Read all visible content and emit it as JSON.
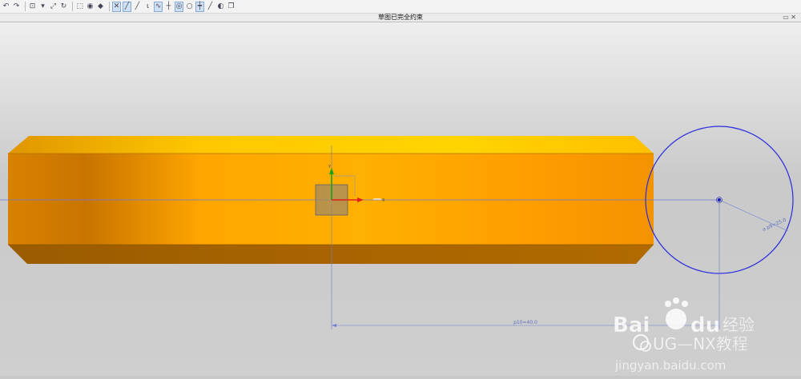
{
  "toolbar": {
    "buttons": [
      {
        "name": "undo-button",
        "glyph": "↶"
      },
      {
        "name": "redo-button",
        "glyph": "↷"
      },
      {
        "name": "select-filter-button",
        "glyph": "⊡"
      },
      {
        "name": "snap-button",
        "glyph": "▾"
      },
      {
        "name": "fit-view-button",
        "glyph": "⤢"
      },
      {
        "name": "refresh-button",
        "glyph": "↻"
      },
      {
        "name": "box-select-button",
        "glyph": "⬚"
      },
      {
        "name": "shaded-view-button",
        "glyph": "◉"
      },
      {
        "name": "cube-view-button",
        "glyph": "◆"
      },
      {
        "name": "profile-tool-button",
        "glyph": "✕",
        "active": true
      },
      {
        "name": "line-tool-button",
        "glyph": "╱",
        "active": true
      },
      {
        "name": "arc-tool-button",
        "glyph": "╱"
      },
      {
        "name": "fillet-tool-button",
        "glyph": "ι"
      },
      {
        "name": "studio-spline-button",
        "glyph": "∿",
        "active": true
      },
      {
        "name": "point-tool-button",
        "glyph": "┼"
      },
      {
        "name": "circle-tool-button",
        "glyph": "◎",
        "active": true
      },
      {
        "name": "polygon-tool-button",
        "glyph": "○"
      },
      {
        "name": "trim-tool-button",
        "glyph": "┿",
        "active": true
      },
      {
        "name": "extend-tool-button",
        "glyph": "╱"
      },
      {
        "name": "mirror-tool-button",
        "glyph": "◐"
      },
      {
        "name": "copy-tool-button",
        "glyph": "❐"
      }
    ]
  },
  "status": {
    "message": "草图已完全约束",
    "right_glyph": "▭ ✕"
  },
  "sketch": {
    "axis_x_label": "X",
    "axis_y_label": "Y",
    "circle_diameter_label": "⌀ p9=25.0",
    "horizontal_dimension_label": "p10=40.0"
  },
  "colors": {
    "body_top": "#ffc400",
    "body_front": "#ff9f00",
    "body_bottom": "#c87800",
    "sketch_blue": "#2a2ae0",
    "dimension_blue": "#6d7fd0"
  },
  "watermark": {
    "brand": "Bai",
    "brand_suffix": "du",
    "brand_cn": "经验",
    "channel": "UG—NX教程",
    "url": "jingyan.baidu.com"
  }
}
